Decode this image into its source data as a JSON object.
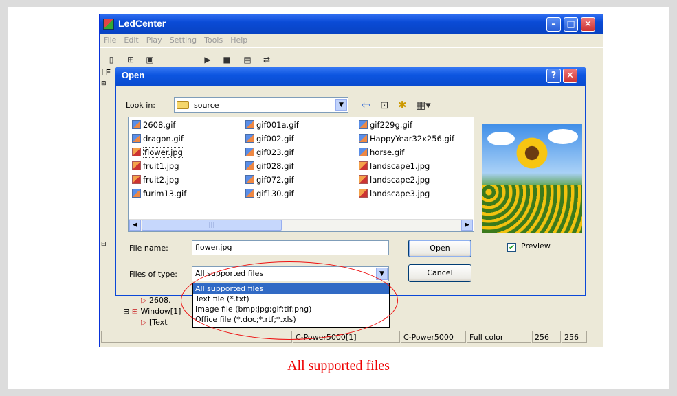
{
  "app": {
    "title": "LedCenter",
    "menu": [
      "File",
      "Edit",
      "Play",
      "Setting",
      "Tools",
      "Help"
    ],
    "left_label": "LE",
    "tree": [
      {
        "label": "2608.",
        "indent": 1
      },
      {
        "label": "Window[1]",
        "indent": 0
      },
      {
        "label": "[Text",
        "indent": 1
      }
    ],
    "status": [
      "C-Power5000[1]",
      "C-Power5000",
      "Full color",
      "256",
      "256"
    ]
  },
  "dialog": {
    "title": "Open",
    "lookin_label": "Look in:",
    "lookin_value": "source",
    "files": [
      [
        "2608.gif",
        "dragon.gif",
        "flower.jpg",
        "fruit1.jpg",
        "fruit2.jpg",
        "furim13.gif"
      ],
      [
        "gif001a.gif",
        "gif002.gif",
        "gif023.gif",
        "gif028.gif",
        "gif072.gif",
        "gif130.gif"
      ],
      [
        "gif229g.gif",
        "HappyYear32x256.gif",
        "horse.gif",
        "landscape1.jpg",
        "landscape2.jpg",
        "landscape3.jpg"
      ]
    ],
    "selected_file": "flower.jpg",
    "file_name_label": "File name:",
    "file_name_value": "flower.jpg",
    "files_of_type_label": "Files of type:",
    "files_of_type_value": "All supported files",
    "open_button": "Open",
    "cancel_button": "Cancel",
    "preview_label": "Preview",
    "preview_checked": true,
    "file_types": [
      "All supported files",
      "Text file (*.txt)",
      "Image file (bmp;jpg;gif;tif;png)",
      "Office file (*.doc;*.rtf;*.xls)"
    ]
  },
  "caption": "All supported files",
  "colors": {
    "annotation": "#e00000",
    "highlight": "#316ac5"
  }
}
